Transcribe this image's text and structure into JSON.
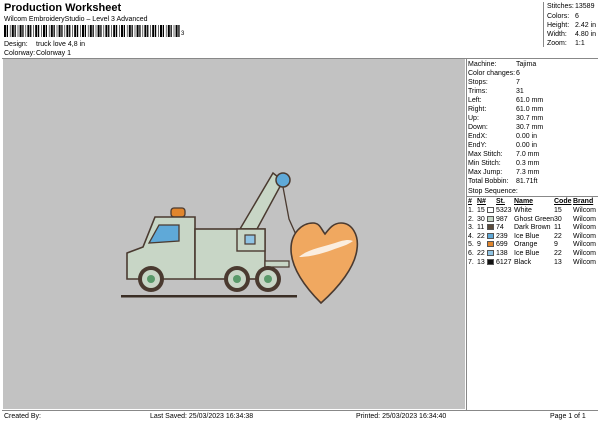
{
  "header": {
    "title": "Production Worksheet",
    "subtitle": "Wilcom EmbroideryStudio – Level 3 Advanced",
    "barcode_number": "3"
  },
  "design_info": [
    {
      "label": "Design:",
      "value": "truck love 4,8 in"
    },
    {
      "label": "Colorway:",
      "value": "Colorway 1"
    }
  ],
  "summary": [
    {
      "label": "Stitches:",
      "value": "13589"
    },
    {
      "label": "Colors:",
      "value": "6"
    },
    {
      "label": "Height:",
      "value": "2.42 in"
    },
    {
      "label": "Width:",
      "value": "4.80 in"
    },
    {
      "label": "Zoom:",
      "value": "1:1"
    }
  ],
  "properties": [
    {
      "label": "Machine:",
      "value": "Tajima"
    },
    {
      "label": "Color changes:",
      "value": "6"
    },
    {
      "label": "Stops:",
      "value": "7"
    },
    {
      "label": "Trims:",
      "value": "31"
    },
    {
      "label": "Left:",
      "value": "61.0 mm"
    },
    {
      "label": "Right:",
      "value": "61.0 mm"
    },
    {
      "label": "Up:",
      "value": "30.7 mm"
    },
    {
      "label": "Down:",
      "value": "30.7 mm"
    },
    {
      "label": "EndX:",
      "value": "0.00 in"
    },
    {
      "label": "EndY:",
      "value": "0.00 in"
    },
    {
      "label": "Max Stitch:",
      "value": "7.0 mm"
    },
    {
      "label": "Min Stitch:",
      "value": "0.3 mm"
    },
    {
      "label": "Max Jump:",
      "value": "7.3 mm"
    },
    {
      "label": "Total Bobbin:",
      "value": "81.71ft"
    }
  ],
  "stop_sequence": {
    "title": "Stop Sequence:",
    "headers": {
      "num": "#",
      "n": "N#",
      "color": "",
      "st": "St.",
      "name": "Name",
      "code": "Code",
      "brand": "Brand"
    },
    "rows": [
      {
        "num": "1.",
        "n": "15",
        "color": "#ffffff",
        "st": "5323",
        "name": "White",
        "code": "15",
        "brand": "Wilcom"
      },
      {
        "num": "2.",
        "n": "30",
        "color": "#c6d8c6",
        "st": "987",
        "name": "Ghost Green",
        "code": "30",
        "brand": "Wilcom"
      },
      {
        "num": "3.",
        "n": "11",
        "color": "#5a4a3a",
        "st": "74",
        "name": "Dark Brown",
        "code": "11",
        "brand": "Wilcom"
      },
      {
        "num": "4.",
        "n": "22",
        "color": "#5fa9d8",
        "st": "239",
        "name": "Ice Blue",
        "code": "22",
        "brand": "Wilcom"
      },
      {
        "num": "5.",
        "n": "9",
        "color": "#e0852c",
        "st": "699",
        "name": "Orange",
        "code": "9",
        "brand": "Wilcom"
      },
      {
        "num": "6.",
        "n": "22",
        "color": "#8fc4e4",
        "st": "138",
        "name": "Ice Blue",
        "code": "22",
        "brand": "Wilcom"
      },
      {
        "num": "7.",
        "n": "13",
        "color": "#111111",
        "st": "6127",
        "name": "Black",
        "code": "13",
        "brand": "Wilcom"
      }
    ]
  },
  "footer": {
    "created_by": "Created By:",
    "last_saved": "Last Saved: 25/03/2023 16:34:38",
    "printed": "Printed: 25/03/2023 16:34:40",
    "page": "Page 1 of 1"
  }
}
